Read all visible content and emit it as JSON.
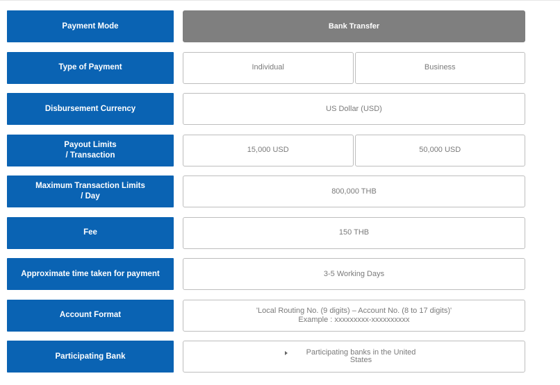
{
  "rows": [
    {
      "label": "Payment Mode",
      "values": [
        "Bank Transfer"
      ]
    },
    {
      "label": "Type of Payment",
      "values": [
        "Individual",
        "Business"
      ]
    },
    {
      "label": "Disbursement Currency",
      "values": [
        "US Dollar (USD)"
      ]
    },
    {
      "label": "Payout Limits\n/ Transaction",
      "values": [
        "15,000 USD",
        "50,000 USD"
      ]
    },
    {
      "label": "Maximum Transaction Limits\n/ Day",
      "values": [
        "800,000 THB"
      ]
    },
    {
      "label": "Fee",
      "values": [
        "150 THB"
      ]
    },
    {
      "label": "Approximate time taken for payment",
      "values": [
        "3-5 Working Days"
      ]
    },
    {
      "label": "Account Format",
      "values": [
        "'Local Routing No. (9 digits) – Account No. (8 to 17 digits)'",
        "Example : xxxxxxxxx-xxxxxxxxxx"
      ]
    },
    {
      "label": "Participating Bank",
      "values": [
        "Participating banks in the United States"
      ]
    }
  ],
  "colors": {
    "label_bg": "#0a63b3",
    "selected_bg": "#7f7f7f",
    "cell_border": "#bdbdbd",
    "cell_text": "#7a7a7a"
  },
  "icons": {
    "disclosure": "triangle-right-icon"
  }
}
